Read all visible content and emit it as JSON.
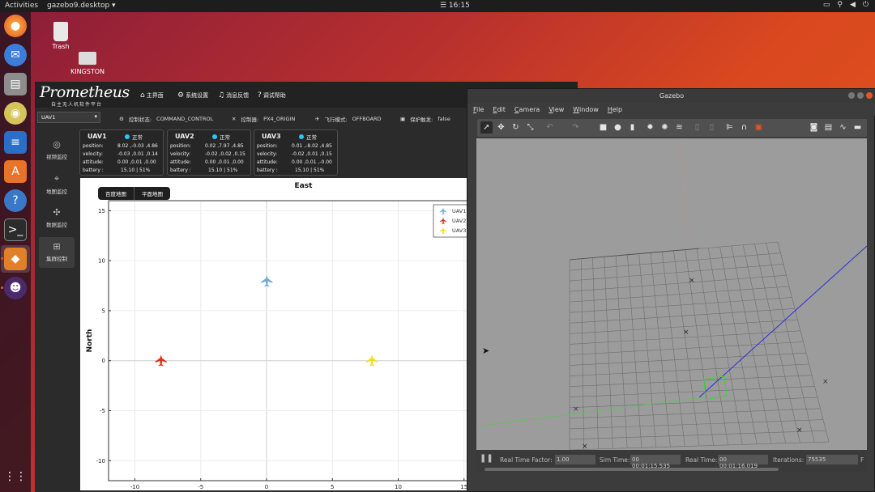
{
  "topbar": {
    "activities": "Activities",
    "app_name": "gazebo9.desktop ▾",
    "clock": "☰ 16:15",
    "tray_icons": [
      "camera-icon",
      "network-icon",
      "volume-icon",
      "power-icon"
    ]
  },
  "desktop": {
    "icons": [
      {
        "label": "Trash"
      },
      {
        "label": "KINGSTON"
      }
    ]
  },
  "prometheus": {
    "logo": "Prometheus",
    "logo_sub": "自主无人机软件平台",
    "menu": [
      "主界面",
      "系统设置",
      "消息反馈",
      "调试帮助"
    ],
    "uav_select": "UAV1",
    "status": {
      "control_state_label": "控制状态:",
      "control_state": "COMMAND_CONTROL",
      "controller_label": "控制器:",
      "controller": "PX4_ORIGIN",
      "flight_mode_label": "飞行模式:",
      "flight_mode": "OFFBOARD",
      "protect_label": "保护触发:",
      "protect": "false"
    },
    "sidebar": [
      "视频监控",
      "地图监控",
      "数据监控",
      "集群控制"
    ],
    "uav_cards": [
      {
        "name": "UAV1",
        "state": "正常",
        "position": "8.02 ,-0.03 ,4.86",
        "velocity": "-0.03 ,0.01 ,0.14",
        "attitude": "0.00 ,0.01 ,0.00",
        "battery": "15.10 | 51%"
      },
      {
        "name": "UAV2",
        "state": "正常",
        "position": "0.02 ,7.97 ,4.85",
        "velocity": "-0.02 ,0.02 ,0.15",
        "attitude": "0.00 ,0.01 ,0.00",
        "battery": "15.10 | 51%"
      },
      {
        "name": "UAV3",
        "state": "正常",
        "position": "0.01 ,-8.02 ,4.85",
        "velocity": "-0.02 ,0.01 ,0.15",
        "attitude": "0.00 ,0.01 ,-0.00",
        "battery": "15.10 | 51%"
      }
    ],
    "card_labels": {
      "position": "position:",
      "velocity": "velocity:",
      "attitude": "attitude:",
      "battery": "battery :"
    },
    "map_tabs": [
      "百度地图",
      "平面地图"
    ]
  },
  "chart_data": {
    "type": "scatter",
    "title": "East",
    "xlabel": "",
    "ylabel": "North",
    "xlim": [
      -12,
      16
    ],
    "ylim": [
      -12,
      16
    ],
    "xticks": [
      -10,
      -5,
      0,
      5,
      10,
      15
    ],
    "yticks": [
      15,
      10,
      5,
      0,
      -5,
      -10
    ],
    "grid": true,
    "legend": "top-right",
    "series": [
      {
        "name": "UAV1",
        "color": "#6fa8dc",
        "x": [
          0.02
        ],
        "y": [
          7.97
        ]
      },
      {
        "name": "UAV2",
        "color": "#d9331f",
        "x": [
          -8.02
        ],
        "y": [
          0.01
        ]
      },
      {
        "name": "UAV3",
        "color": "#f0e021",
        "x": [
          8.0
        ],
        "y": [
          0.02
        ]
      }
    ]
  },
  "gazebo": {
    "title": "Gazebo",
    "menu": [
      "File",
      "Edit",
      "Camera",
      "View",
      "Window",
      "Help"
    ],
    "bottom": {
      "rtf_label": "Real Time Factor:",
      "rtf": "1.00",
      "sim_label": "Sim Time:",
      "sim": "00 00:01:15.535",
      "real_label": "Real Time:",
      "real": "00 00:01:16.019",
      "iter_label": "Iterations:",
      "iter": "75535",
      "fps_label": "F"
    }
  }
}
